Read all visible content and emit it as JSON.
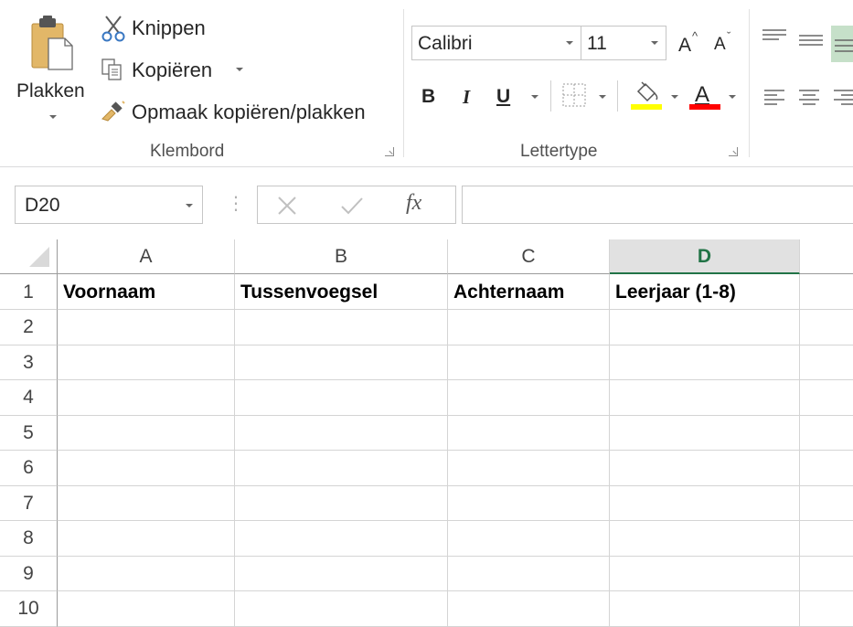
{
  "clipboard": {
    "paste_label": "Plakken",
    "cut_label": "Knippen",
    "copy_label": "Kopiëren",
    "format_painter_label": "Opmaak kopiëren/plakken",
    "group_label": "Klembord"
  },
  "font": {
    "font_name": "Calibri",
    "font_size": "11",
    "grow_label": "A",
    "shrink_label": "A",
    "bold_label": "B",
    "italic_label": "I",
    "underline_label": "U",
    "font_color_label": "A",
    "group_label": "Lettertype",
    "highlight_color": "#ffff00",
    "font_color": "#ff0000"
  },
  "formula_bar": {
    "name_box": "D20",
    "fx_label": "fx",
    "formula": ""
  },
  "sheet": {
    "columns": [
      "A",
      "B",
      "C",
      "D"
    ],
    "selected_column": "D",
    "rows": [
      "1",
      "2",
      "3",
      "4",
      "5",
      "6",
      "7",
      "8",
      "9",
      "10"
    ],
    "cells": {
      "A1": "Voornaam",
      "B1": "Tussenvoegsel",
      "C1": "Achternaam",
      "D1": "Leerjaar (1-8)"
    }
  },
  "colors": {
    "accent": "#217346"
  }
}
